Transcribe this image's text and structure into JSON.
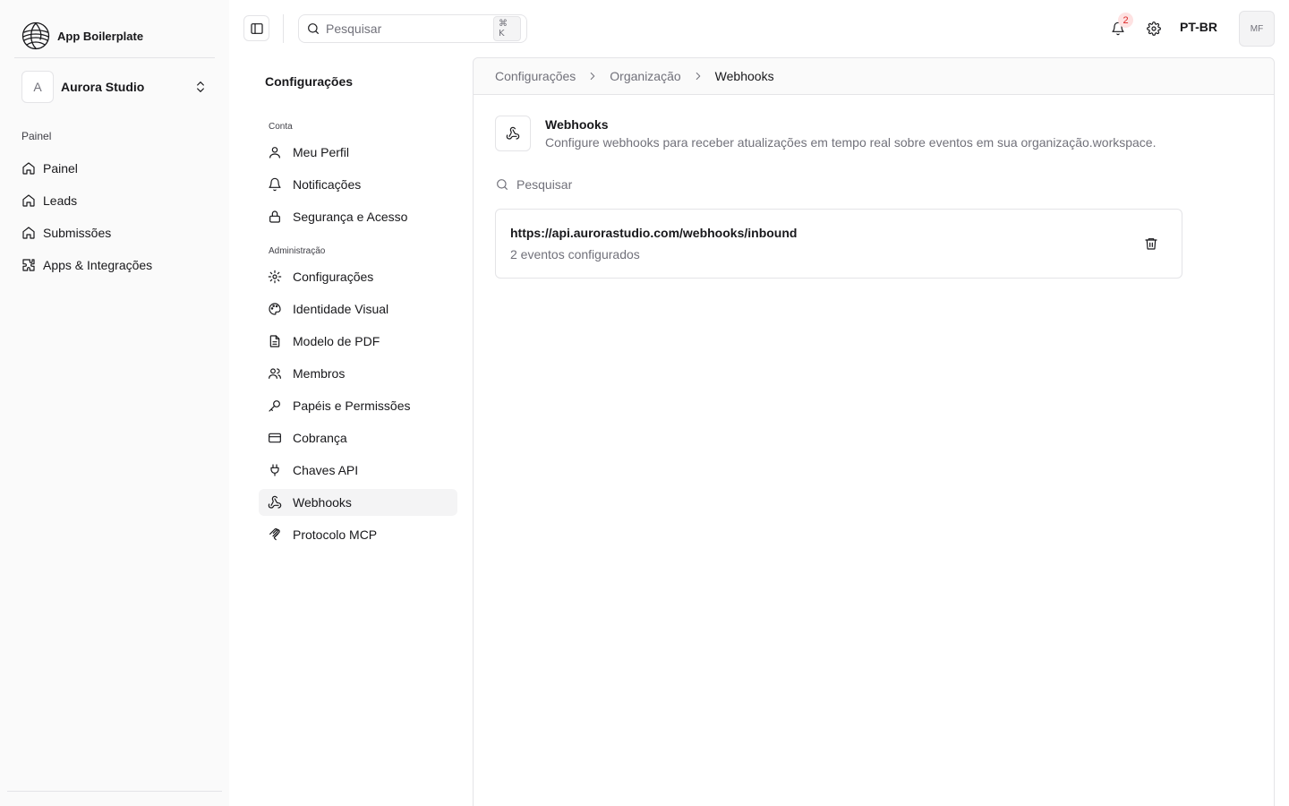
{
  "app": {
    "brand_name": "App Boilerplate",
    "org_initial": "A",
    "org_name": "Aurora Studio"
  },
  "sidebar": {
    "section_label": "Painel",
    "items": [
      {
        "label": "Painel",
        "icon": "home-icon"
      },
      {
        "label": "Leads",
        "icon": "home-icon"
      },
      {
        "label": "Submissões",
        "icon": "home-icon"
      },
      {
        "label": "Apps & Integrações",
        "icon": "puzzle-icon"
      }
    ]
  },
  "topbar": {
    "search_placeholder": "Pesquisar",
    "search_shortcut": "⌘ K",
    "notification_count": "2",
    "language": "PT-BR",
    "user_initials": "MF"
  },
  "settings_nav": {
    "title": "Configurações",
    "groups": [
      {
        "label": "Conta",
        "items": [
          {
            "label": "Meu Perfil",
            "icon": "user-icon"
          },
          {
            "label": "Notificações",
            "icon": "bell-icon"
          },
          {
            "label": "Segurança e Acesso",
            "icon": "lock-icon"
          }
        ]
      },
      {
        "label": "Administração",
        "items": [
          {
            "label": "Configurações",
            "icon": "gear-icon"
          },
          {
            "label": "Identidade Visual",
            "icon": "palette-icon"
          },
          {
            "label": "Modelo de PDF",
            "icon": "file-text-icon"
          },
          {
            "label": "Membros",
            "icon": "users-icon"
          },
          {
            "label": "Papéis e Permissões",
            "icon": "key-icon"
          },
          {
            "label": "Cobrança",
            "icon": "credit-card-icon"
          },
          {
            "label": "Chaves API",
            "icon": "plug-icon"
          },
          {
            "label": "Webhooks",
            "icon": "webhook-icon",
            "active": true
          },
          {
            "label": "Protocolo MCP",
            "icon": "mcp-icon"
          }
        ]
      }
    ]
  },
  "breadcrumb": [
    "Configurações",
    "Organização",
    "Webhooks"
  ],
  "webhooks_page": {
    "title": "Webhooks",
    "description": "Configure webhooks para receber atualizações em tempo real sobre eventos em sua organização.workspace.",
    "search_placeholder": "Pesquisar",
    "items": [
      {
        "url": "https://api.aurorastudio.com/webhooks/inbound",
        "events": "2 eventos configurados"
      }
    ]
  },
  "colors": {
    "sidebar_bg": "#fafafa",
    "border": "#e4e4e7",
    "muted_text": "#71717a",
    "badge_bg": "#fee2e2",
    "badge_text": "#dc2626",
    "active_item_bg": "#f4f4f5"
  }
}
